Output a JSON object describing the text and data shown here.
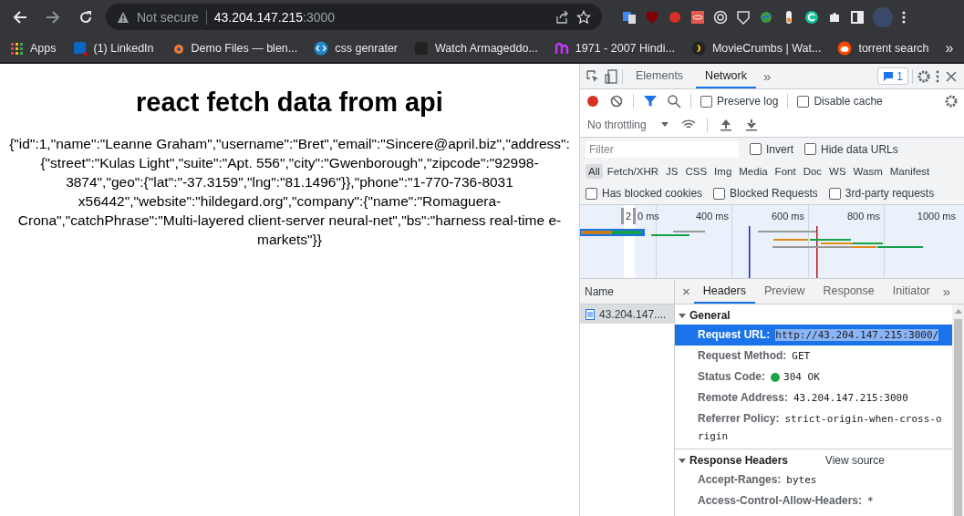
{
  "browser": {
    "security_label": "Not secure",
    "host": "43.204.147.215",
    "port": ":3000",
    "bookmarks": [
      {
        "label": "Apps"
      },
      {
        "label": "(1) LinkedIn"
      },
      {
        "label": "Demo Files — blen..."
      },
      {
        "label": "css genrater"
      },
      {
        "label": "Watch Armageddo..."
      },
      {
        "label": "1971 - 2007 Hindi..."
      },
      {
        "label": "MovieCrumbs | Wat..."
      },
      {
        "label": "torrent search"
      }
    ],
    "bookmarks_more": "»"
  },
  "page": {
    "heading": "react fetch data from api",
    "body": "{\"id\":1,\"name\":\"Leanne Graham\",\"username\":\"Bret\",\"email\":\"Sincere@april.biz\",\"address\":{\"street\":\"Kulas Light\",\"suite\":\"Apt. 556\",\"city\":\"Gwenborough\",\"zipcode\":\"92998-3874\",\"geo\":{\"lat\":\"-37.3159\",\"lng\":\"81.1496\"}},\"phone\":\"1-770-736-8031 x56442\",\"website\":\"hildegard.org\",\"company\":{\"name\":\"Romaguera-Crona\",\"catchPhrase\":\"Multi-layered client-server neural-net\",\"bs\":\"harness real-time e-markets\"}}"
  },
  "devtools": {
    "tabs": [
      {
        "label": "Elements",
        "selected": false
      },
      {
        "label": "Network",
        "selected": true
      }
    ],
    "tabs_more": "»",
    "issues_count": "1",
    "preserve_log": {
      "label": "Preserve log",
      "checked": false
    },
    "disable_cache": {
      "label": "Disable cache",
      "checked": false
    },
    "throttling": "No throttling",
    "filter": {
      "placeholder": "Filter"
    },
    "filter_options": [
      {
        "label": "Invert",
        "checked": false
      },
      {
        "label": "Hide data URLs",
        "checked": false
      }
    ],
    "types": [
      {
        "label": "All",
        "selected": true
      },
      {
        "label": "Fetch/XHR",
        "selected": false
      },
      {
        "label": "JS",
        "selected": false
      },
      {
        "label": "CSS",
        "selected": false
      },
      {
        "label": "Img",
        "selected": false
      },
      {
        "label": "Media",
        "selected": false
      },
      {
        "label": "Font",
        "selected": false
      },
      {
        "label": "Doc",
        "selected": false
      },
      {
        "label": "WS",
        "selected": false
      },
      {
        "label": "Wasm",
        "selected": false
      },
      {
        "label": "Manifest",
        "selected": false
      }
    ],
    "block_options": [
      {
        "label": "Has blocked cookies",
        "checked": false
      },
      {
        "label": "Blocked Requests",
        "checked": false
      },
      {
        "label": "3rd-party requests",
        "checked": false
      }
    ],
    "waterfall": {
      "first_tick_parts": [
        "2",
        "0 ms"
      ],
      "ticks": [
        "400 ms",
        "600 ms",
        "800 ms",
        "1000 ms"
      ]
    },
    "name_header": "Name",
    "requests": [
      {
        "name": "43.204.147....",
        "selected": true
      }
    ],
    "detail_close": "×",
    "detail_tabs": [
      {
        "label": "Headers",
        "selected": true
      },
      {
        "label": "Preview",
        "selected": false
      },
      {
        "label": "Response",
        "selected": false
      },
      {
        "label": "Initiator",
        "selected": false
      }
    ],
    "detail_more": "»",
    "general": {
      "title": "General",
      "expanded": true,
      "rows": [
        {
          "kind": "field",
          "key": "Request URL:",
          "value": "http://43.204.147.215:3000/",
          "selected": true
        },
        {
          "kind": "field",
          "key": "Request Method:",
          "value": "GET",
          "selected": false
        },
        {
          "kind": "status",
          "key": "Status Code:",
          "value": "304 OK",
          "selected": false
        },
        {
          "kind": "field",
          "key": "Remote Address:",
          "value": "43.204.147.215:3000",
          "selected": false
        },
        {
          "kind": "field",
          "key": "Referrer Policy:",
          "value": "strict-origin-when-cross-origin",
          "selected": false
        }
      ]
    },
    "response_headers": {
      "title": "Response Headers",
      "expanded": true,
      "view_source": "View source",
      "rows": [
        {
          "key": "Accept-Ranges:",
          "value": "bytes"
        },
        {
          "key": "Access-Control-Allow-Headers:",
          "value": "*"
        }
      ]
    }
  }
}
